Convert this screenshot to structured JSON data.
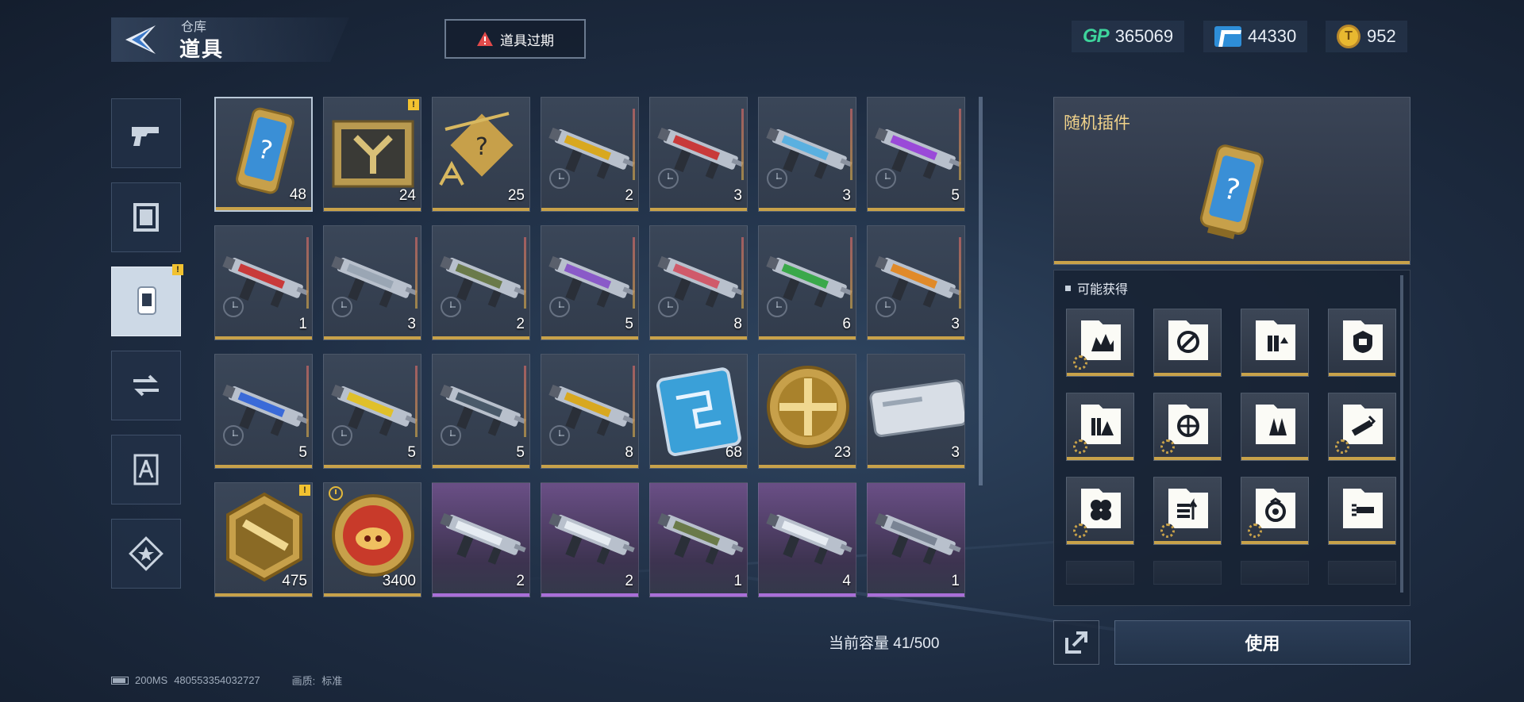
{
  "header": {
    "breadcrumb": "仓库",
    "title": "道具",
    "expire_button": "道具过期"
  },
  "currencies": [
    {
      "icon": "gp-icon",
      "label": "GP",
      "value": "365069"
    },
    {
      "icon": "ticket-icon",
      "value": "44330"
    },
    {
      "icon": "coin-icon",
      "value": "952"
    }
  ],
  "side_tabs": [
    {
      "icon": "pistol-icon"
    },
    {
      "icon": "frame-icon"
    },
    {
      "icon": "plugin-card-icon",
      "active": true,
      "badge": "!"
    },
    {
      "icon": "swap-icon"
    },
    {
      "icon": "blueprint-icon"
    },
    {
      "icon": "star-badge-icon"
    }
  ],
  "items": [
    {
      "name": "random-plugin",
      "count": "48",
      "selected": true
    },
    {
      "name": "supply-crate",
      "count": "24",
      "badge": "!"
    },
    {
      "name": "mystery-blueprint",
      "count": "25"
    },
    {
      "name": "weapon-rifle-gold",
      "count": "2",
      "timed": true
    },
    {
      "name": "weapon-rifle-red",
      "count": "3",
      "timed": true
    },
    {
      "name": "weapon-rifle-cyan",
      "count": "3",
      "timed": true
    },
    {
      "name": "weapon-rifle-purple",
      "count": "5",
      "timed": true
    },
    {
      "name": "weapon-sniper-red",
      "count": "1",
      "timed": true
    },
    {
      "name": "weapon-sniper-silver",
      "count": "3",
      "timed": true
    },
    {
      "name": "weapon-lmg-camo",
      "count": "2",
      "timed": true
    },
    {
      "name": "weapon-sniper-violet",
      "count": "5",
      "timed": true
    },
    {
      "name": "weapon-rifle-pink",
      "count": "8",
      "timed": true
    },
    {
      "name": "weapon-rifle-green",
      "count": "6",
      "timed": true
    },
    {
      "name": "weapon-smg-orange",
      "count": "3",
      "timed": true
    },
    {
      "name": "weapon-knife-blue",
      "count": "5",
      "timed": true
    },
    {
      "name": "weapon-smg-yellow",
      "count": "5",
      "timed": true
    },
    {
      "name": "weapon-rifle-dark",
      "count": "5",
      "timed": true
    },
    {
      "name": "weapon-shotgun-gold",
      "count": "8",
      "timed": true
    },
    {
      "name": "chip-card",
      "count": "68"
    },
    {
      "name": "gold-medal",
      "count": "23"
    },
    {
      "name": "silver-case",
      "count": "3"
    },
    {
      "name": "rifle-badge",
      "count": "475",
      "badge": "!"
    },
    {
      "name": "pig-coin",
      "count": "3400",
      "clock": true
    },
    {
      "name": "weapon-smg-white",
      "count": "2",
      "purple": true
    },
    {
      "name": "weapon-rifle-white",
      "count": "2",
      "purple": true
    },
    {
      "name": "weapon-rifle-camo",
      "count": "1",
      "purple": true
    },
    {
      "name": "weapon-sniper-white",
      "count": "4",
      "purple": true
    },
    {
      "name": "weapon-smg-grey",
      "count": "1",
      "purple": true
    }
  ],
  "capacity": {
    "label": "当前容量",
    "value": "41/500"
  },
  "detail": {
    "title": "随机插件",
    "obtain_title": "可能获得",
    "plugins": [
      "crown-arrows-icon",
      "rotate-slash-icon",
      "bullets-up-icon",
      "shield-hand-icon",
      "ammo-warning-icon",
      "crosshair-icon",
      "rockets-icon",
      "gun-up-icon",
      "clover-icon",
      "lines-up-icon",
      "target-up-icon",
      "gun-fast-icon"
    ]
  },
  "use_button": "使用",
  "status": {
    "ping": "200MS",
    "id": "480553354032727",
    "quality_label": "画质:",
    "quality_value": "标准"
  }
}
